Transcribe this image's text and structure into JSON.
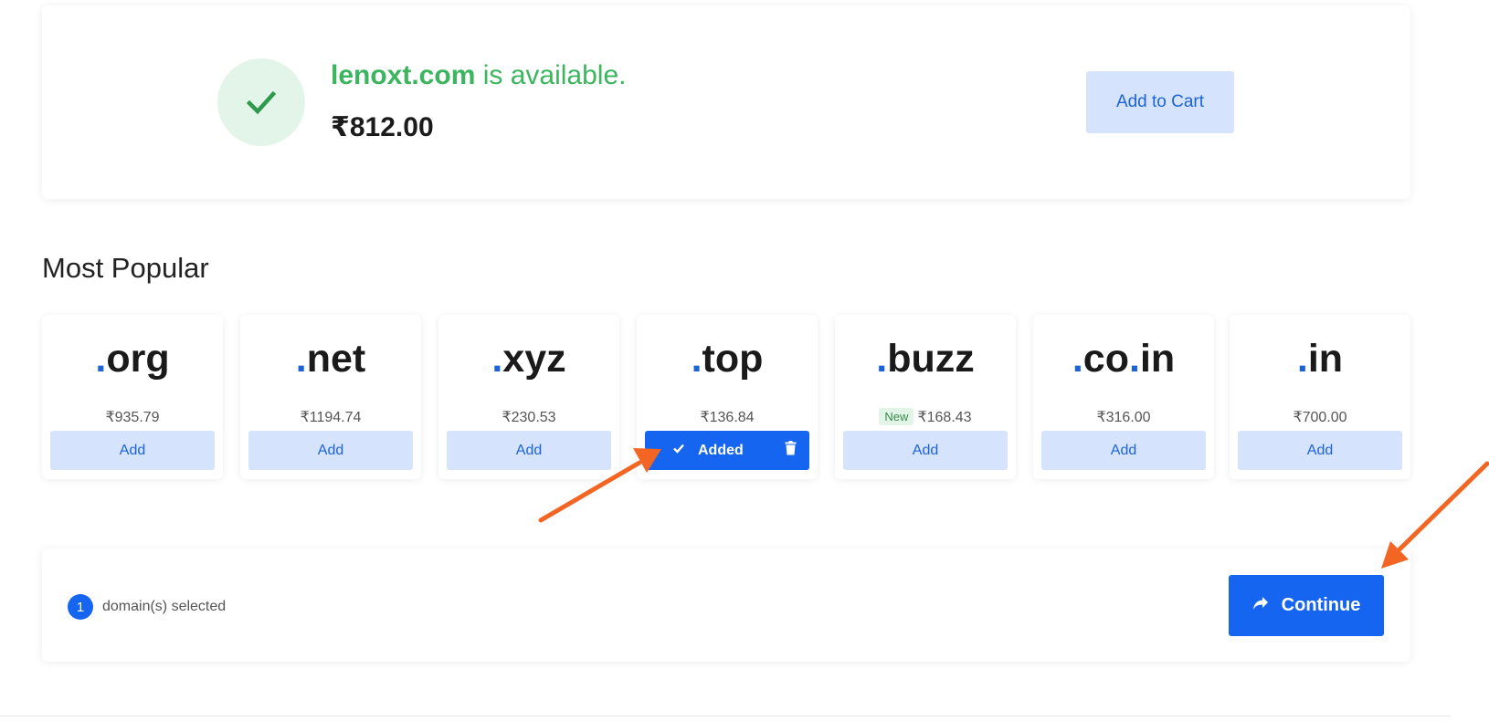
{
  "availability": {
    "domain": "lenoxt.com",
    "status_text": " is available.",
    "price": "₹812.00",
    "add_to_cart_label": "Add to Cart",
    "status_color": "#3bb55e"
  },
  "most_popular": {
    "title": "Most Popular",
    "tlds": [
      {
        "name": "org",
        "price": "₹935.79",
        "button": "Add"
      },
      {
        "name": "net",
        "price": "₹1194.74",
        "button": "Add"
      },
      {
        "name": "xyz",
        "price": "₹230.53",
        "button": "Add"
      },
      {
        "name": "top",
        "price": "₹136.84",
        "button": "Added",
        "state": "added"
      },
      {
        "name": "buzz",
        "price": "₹168.43",
        "badge": "New",
        "button": "Add"
      },
      {
        "name_parts": [
          "co",
          "in"
        ],
        "price": "₹316.00",
        "button": "Add"
      },
      {
        "name": "in",
        "price": "₹700.00",
        "button": "Add"
      }
    ]
  },
  "selection_bar": {
    "count": "1",
    "label": "domain(s) selected",
    "continue_label": "Continue"
  },
  "colors": {
    "accent": "#1565f0",
    "light_button": "#d5e3fc",
    "annotation_arrow": "#f26522"
  },
  "icons": [
    "checkmark-icon",
    "trash-icon",
    "share-arrow-icon"
  ]
}
